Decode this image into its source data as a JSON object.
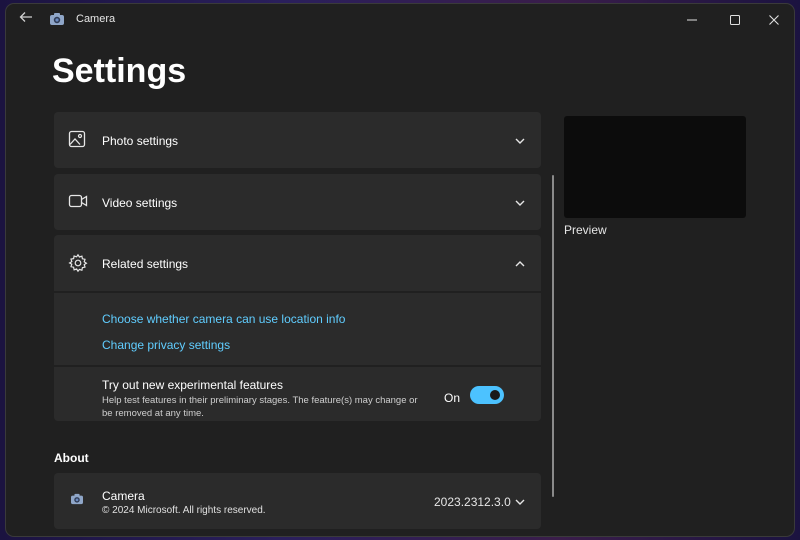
{
  "window": {
    "app_title": "Camera",
    "icons": {
      "back": "back-arrow-icon",
      "app": "camera-icon",
      "minimize": "minimize-icon",
      "maximize": "maximize-icon",
      "close": "close-icon"
    }
  },
  "page_title": "Settings",
  "sections": {
    "photo": {
      "label": "Photo settings",
      "icon": "image-icon",
      "expanded": false
    },
    "video": {
      "label": "Video settings",
      "icon": "video-camera-icon",
      "expanded": false
    },
    "related": {
      "label": "Related settings",
      "icon": "gear-icon",
      "expanded": true,
      "links": [
        "Choose whether camera can use location info",
        "Change privacy settings"
      ]
    },
    "experimental": {
      "title": "Try out new experimental features",
      "description": "Help test features in their preliminary stages. The feature(s) may change or be removed at any time.",
      "state_label": "On",
      "enabled": true
    }
  },
  "about": {
    "section_label": "About",
    "app_name": "Camera",
    "copyright": "© 2024 Microsoft. All rights reserved.",
    "version": "2023.2312.3.0"
  },
  "preview": {
    "label": "Preview"
  },
  "colors": {
    "accent": "#4cc2ff",
    "link": "#60cdff",
    "background": "#202020",
    "card": "#2b2b2b"
  }
}
